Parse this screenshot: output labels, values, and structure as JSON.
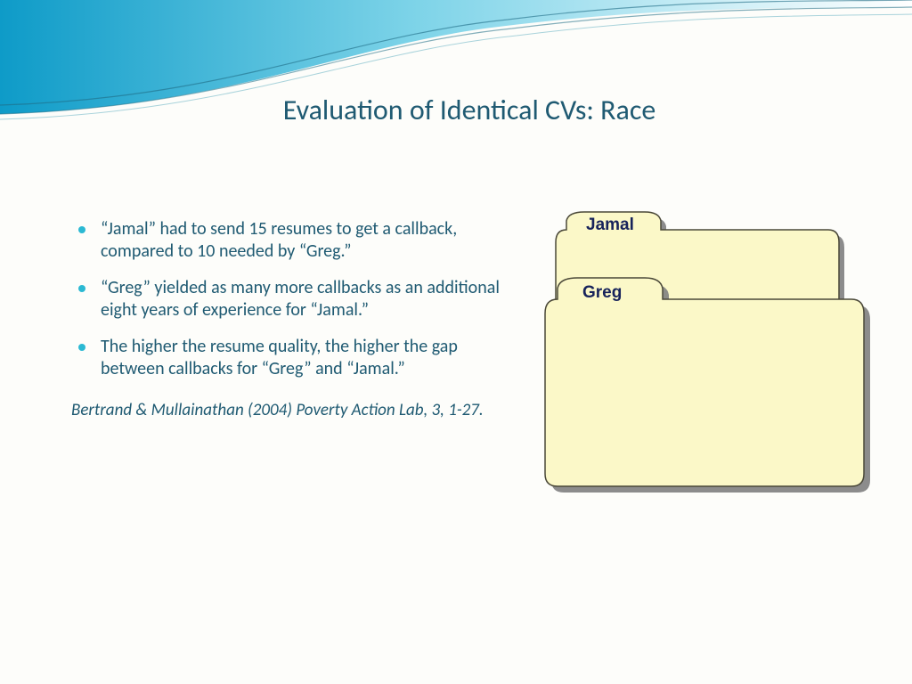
{
  "title": "Evaluation of Identical CVs: Race",
  "bullets": [
    "“Jamal” had to send 15 resumes to get a callback, compared to 10 needed by “Greg.”",
    "“Greg” yielded as many more callbacks as an additional eight years of experience for “Jamal.”",
    "The higher the resume quality, the higher the gap between callbacks for “Greg” and “Jamal.”"
  ],
  "citation": "Bertrand & Mullainathan (2004) Poverty Action Lab, 3, 1-27.",
  "folders": {
    "back_label": "Jamal",
    "front_label": "Greg"
  }
}
